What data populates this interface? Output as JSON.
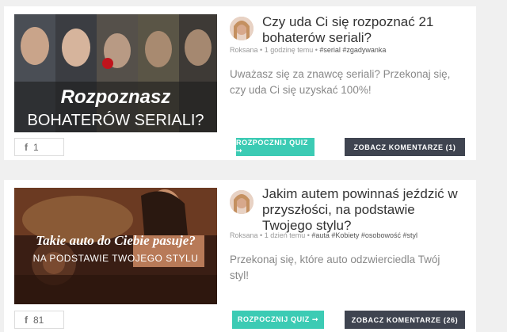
{
  "quizzes": [
    {
      "image_caption_line1": "Rozpoznasz",
      "image_caption_line2": "BOHATERÓW SERIALI?",
      "likes": "1",
      "title": "Czy uda Ci się rozpoznać 21 bohaterów seriali?",
      "author": "Roksana",
      "time": "1 godzinę temu",
      "tags": "#serial #zgadywanka",
      "description": "Uważasz się za znawcę seriali? Przekonaj się, czy uda Ci się uzyskać 100%!",
      "start_label": "ROZPOCZNIJ QUIZ ➞",
      "comments_label": "ZOBACZ KOMENTARZE (1)"
    },
    {
      "image_caption_line1": "Takie auto do Ciebie pasuje?",
      "image_caption_line2": "NA PODSTAWIE TWOJEGO STYLU",
      "likes": "81",
      "title": "Jakim autem powinnaś jeździć w przyszłości, na podstawie Twojego stylu?",
      "author": "Roksana",
      "time": "1 dzień temu",
      "tags": "#auta #Kobiety #osobowość #styl",
      "description": "Przekonaj się, które auto odzwierciedla Twój styl!",
      "start_label": "ROZPOCZNIJ QUIZ ➞",
      "comments_label": "ZOBACZ KOMENTARZE (26)"
    }
  ],
  "separator": " • ",
  "fb_icon": "f"
}
